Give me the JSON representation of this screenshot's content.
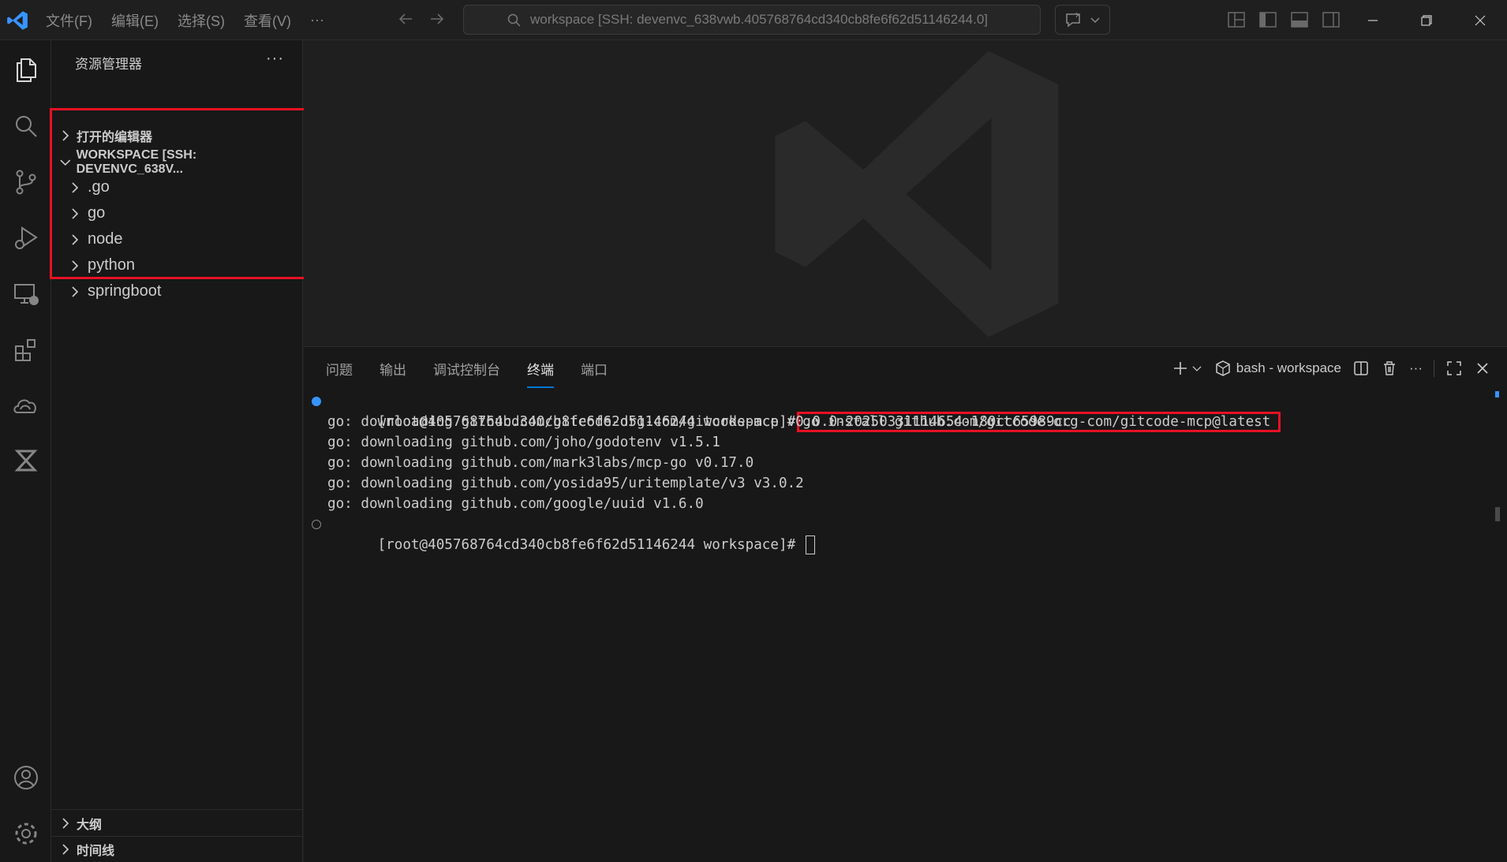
{
  "titlebar": {
    "menu": [
      "文件(F)",
      "编辑(E)",
      "选择(S)",
      "查看(V)",
      "···"
    ],
    "search_text": "workspace [SSH: devenvc_638vwb.405768764cd340cb8fe6f62d51146244.0]"
  },
  "sidebar": {
    "title": "资源管理器",
    "more": "···",
    "open_editors": "打开的编辑器",
    "workspace_label": "WORKSPACE [SSH: DEVENVC_638V...",
    "folders": [
      ".go",
      "go",
      "node",
      "python",
      "springboot"
    ],
    "outline": "大纲",
    "timeline": "时间线"
  },
  "panel": {
    "tabs": [
      "问题",
      "输出",
      "调试控制台",
      "终端",
      "端口"
    ],
    "active_tab": "终端",
    "terminal_name": "bash - workspace",
    "more": "···"
  },
  "terminal": {
    "prompt": "[root@405768764cd340cb8fe6f62d51146244 workspace]#",
    "command": "go install github.com/gitcode-org-com/gitcode-mcp@latest",
    "output": [
      "go: downloading github.com/gitcode-org-com/gitcode-mcp v0.0.0-20250331114654-180cc65989cc",
      "go: downloading github.com/joho/godotenv v1.5.1",
      "go: downloading github.com/mark3labs/mcp-go v0.17.0",
      "go: downloading github.com/yosida95/uritemplate/v3 v3.0.2",
      "go: downloading github.com/google/uuid v1.6.0"
    ],
    "prompt2": "[root@405768764cd340cb8fe6f62d51146244 workspace]#"
  },
  "colors": {
    "accent": "#0078d4",
    "highlight_box": "#e81123",
    "background": "#1f1f1f",
    "sidebar_bg": "#181818"
  }
}
